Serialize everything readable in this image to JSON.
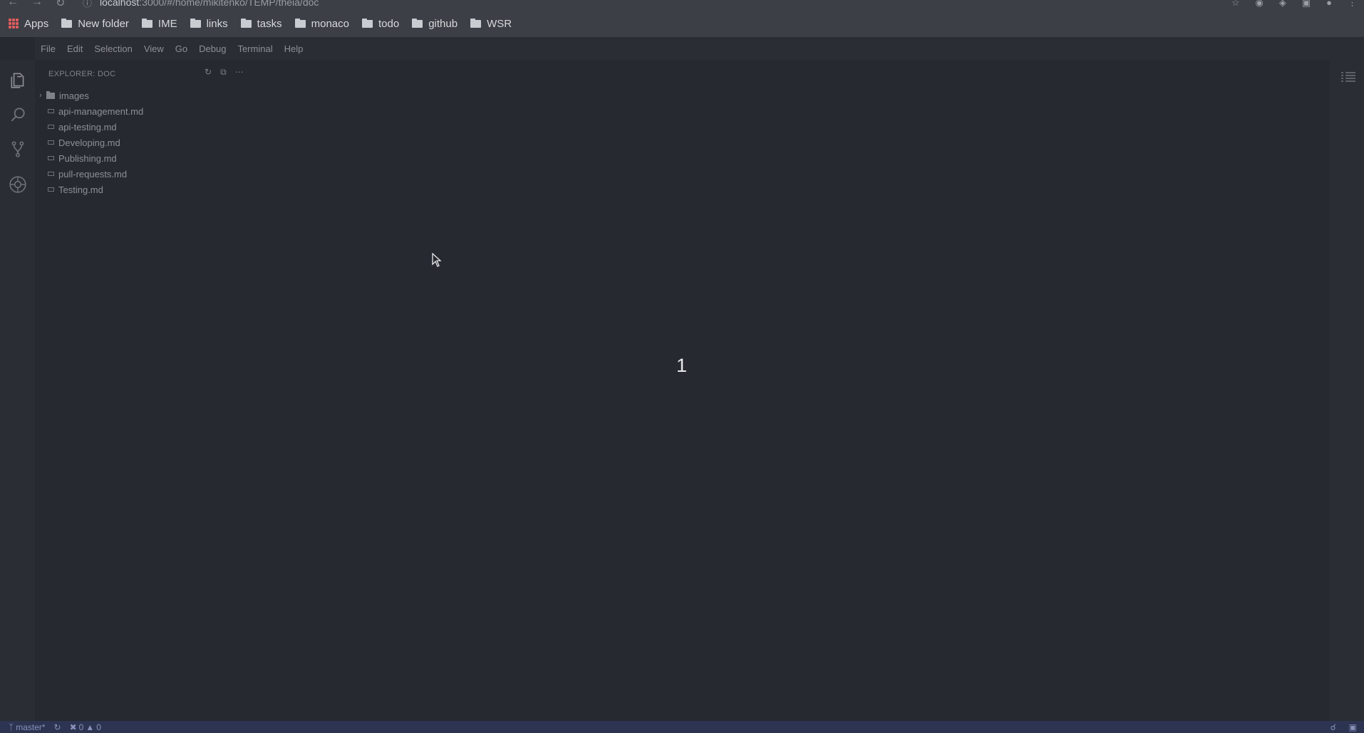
{
  "browser": {
    "url_host": "localhost",
    "url_path": ":3000/#/home/mikitenko/TEMP/theia/doc",
    "bookmarks": [
      {
        "label": "Apps",
        "icon": "apps-icon"
      },
      {
        "label": "New folder",
        "icon": "folder-icon"
      },
      {
        "label": "IME",
        "icon": "folder-icon"
      },
      {
        "label": "links",
        "icon": "folder-icon"
      },
      {
        "label": "tasks",
        "icon": "folder-icon"
      },
      {
        "label": "monaco",
        "icon": "folder-icon"
      },
      {
        "label": "todo",
        "icon": "folder-icon"
      },
      {
        "label": "github",
        "icon": "folder-icon"
      },
      {
        "label": "WSR",
        "icon": "folder-icon"
      }
    ]
  },
  "menubar": {
    "items": [
      "File",
      "Edit",
      "Selection",
      "View",
      "Go",
      "Debug",
      "Terminal",
      "Help"
    ]
  },
  "explorer": {
    "title": "EXPLORER: DOC",
    "folder": "images",
    "files": [
      "api-management.md",
      "api-testing.md",
      "Developing.md",
      "Publishing.md",
      "pull-requests.md",
      "Testing.md"
    ]
  },
  "editor": {
    "step_number": "1"
  },
  "statusbar": {
    "branch": "master*",
    "errors": "0",
    "warnings": "0"
  },
  "colors": {
    "background": "#262930",
    "statusbar": "#2d3452",
    "menubar": "#2a2d33"
  }
}
